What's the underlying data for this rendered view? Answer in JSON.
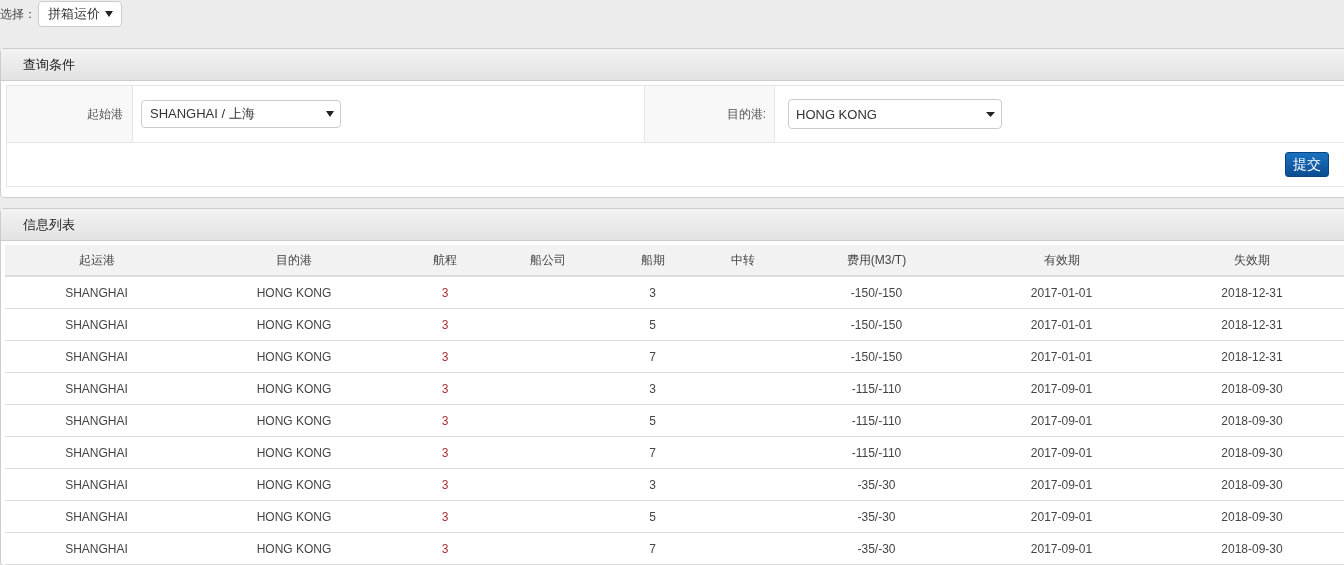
{
  "selector": {
    "label": "选择：",
    "value": "拼箱运价"
  },
  "query_panel": {
    "title": "查询条件",
    "origin_label": "起始港",
    "origin_value": "SHANGHAI / 上海",
    "destination_label": "目的港:",
    "destination_value": "HONG KONG",
    "submit": "提交"
  },
  "list_panel": {
    "title": "信息列表",
    "columns": [
      "起运港",
      "目的港",
      "航程",
      "船公司",
      "船期",
      "中转",
      "费用(M3/T)",
      "有效期",
      "失效期"
    ],
    "rows": [
      [
        "SHANGHAI",
        "HONG KONG",
        "3",
        "",
        "3",
        "",
        "-150/-150",
        "2017-01-01",
        "2018-12-31"
      ],
      [
        "SHANGHAI",
        "HONG KONG",
        "3",
        "",
        "5",
        "",
        "-150/-150",
        "2017-01-01",
        "2018-12-31"
      ],
      [
        "SHANGHAI",
        "HONG KONG",
        "3",
        "",
        "7",
        "",
        "-150/-150",
        "2017-01-01",
        "2018-12-31"
      ],
      [
        "SHANGHAI",
        "HONG KONG",
        "3",
        "",
        "3",
        "",
        "-115/-110",
        "2017-09-01",
        "2018-09-30"
      ],
      [
        "SHANGHAI",
        "HONG KONG",
        "3",
        "",
        "5",
        "",
        "-115/-110",
        "2017-09-01",
        "2018-09-30"
      ],
      [
        "SHANGHAI",
        "HONG KONG",
        "3",
        "",
        "7",
        "",
        "-115/-110",
        "2017-09-01",
        "2018-09-30"
      ],
      [
        "SHANGHAI",
        "HONG KONG",
        "3",
        "",
        "3",
        "",
        "-35/-30",
        "2017-09-01",
        "2018-09-30"
      ],
      [
        "SHANGHAI",
        "HONG KONG",
        "3",
        "",
        "5",
        "",
        "-35/-30",
        "2017-09-01",
        "2018-09-30"
      ],
      [
        "SHANGHAI",
        "HONG KONG",
        "3",
        "",
        "7",
        "",
        "-35/-30",
        "2017-09-01",
        "2018-09-30"
      ]
    ]
  }
}
